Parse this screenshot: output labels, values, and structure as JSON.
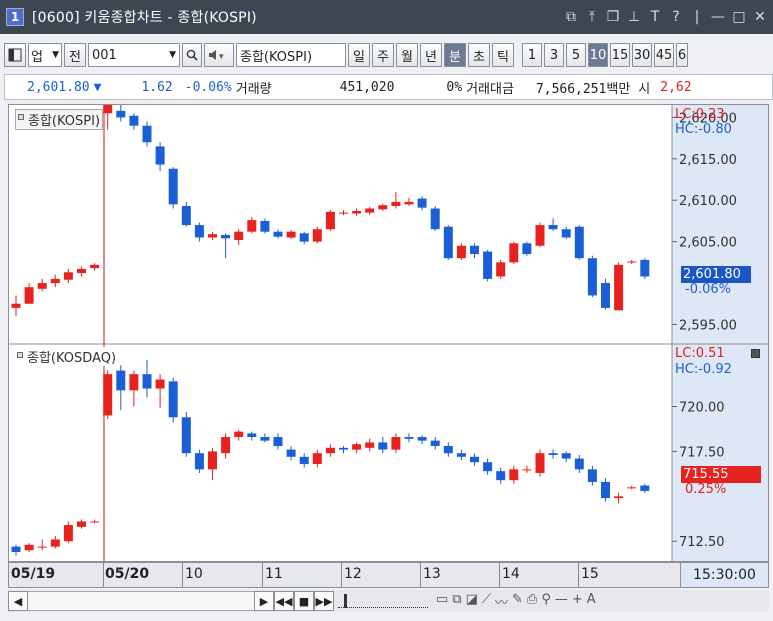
{
  "window": {
    "number": "1",
    "title": "[0600] 키움종합차트 - 종합(KOSPI)",
    "controls": [
      "⧉",
      "⤒",
      "❐",
      "⊥",
      "T",
      "?",
      "|",
      "—",
      "□",
      "✕"
    ]
  },
  "toolbar": {
    "market": "업",
    "market_full": "전",
    "code": "001",
    "name": "종합(KOSPI)",
    "periods": [
      "일",
      "주",
      "월",
      "년",
      "분",
      "초",
      "틱"
    ],
    "active_period": "분",
    "intervals": [
      "1",
      "3",
      "5",
      "10",
      "15",
      "30",
      "45",
      "6"
    ],
    "active_interval": "10"
  },
  "price_line": {
    "price": "2,601.80",
    "arrow": "▼",
    "change": "1.62",
    "change_pct": "-0.06%",
    "volume_label": "거래량",
    "volume": "451,020",
    "volume_pct": "0%",
    "amount_label": "거래대금",
    "amount": "7,566,251백만",
    "open_label": "시",
    "open": "2,62"
  },
  "pane1": {
    "title": "종합(KOSPI)",
    "lc": "LC:0.23",
    "hc": "HC:-0.80",
    "ticks": [
      "2,620.00",
      "2,615.00",
      "2,610.00",
      "2,605.00",
      "2,595.00"
    ],
    "last_price": "2,601.80",
    "last_pct": "-0.06%"
  },
  "pane2": {
    "title": "종합(KOSDAQ)",
    "lc": "LC:0.51",
    "hc": "HC:-0.92",
    "ticks": [
      "720.00",
      "717.50",
      "712.50"
    ],
    "last_price": "715.55",
    "last_pct": "0.25%"
  },
  "x_axis": {
    "labels": [
      "05/19",
      "05/20",
      "10",
      "11",
      "12",
      "13",
      "14",
      "15"
    ],
    "time": "15:30:00"
  },
  "colors": {
    "up": "#e8231f",
    "down": "#1b5fd6",
    "divider": "#d01515"
  },
  "chart_data": [
    {
      "type": "candlestick",
      "title": "종합(KOSPI)",
      "ylim": [
        2593,
        2621.5
      ],
      "candles": [
        [
          2597.0,
          2597.5,
          2596.0,
          2598.5
        ],
        [
          2597.5,
          2599.5,
          2597.5,
          2600.0
        ],
        [
          2599.3,
          2600.0,
          2599.0,
          2600.5
        ],
        [
          2600.0,
          2600.5,
          2599.5,
          2601.0
        ],
        [
          2600.4,
          2601.3,
          2600.0,
          2601.7
        ],
        [
          2601.2,
          2601.7,
          2600.8,
          2602.0
        ],
        [
          2601.8,
          2602.2,
          2601.5,
          2602.4
        ],
        [
          2620.5,
          2623.0,
          2618.5,
          2623.5
        ],
        [
          2620.8,
          2620.0,
          2619.5,
          2621.5
        ],
        [
          2620.2,
          2619.0,
          2618.5,
          2620.5
        ],
        [
          2619.0,
          2617.0,
          2616.5,
          2619.5
        ],
        [
          2616.5,
          2614.3,
          2613.5,
          2617.0
        ],
        [
          2613.8,
          2609.5,
          2609.0,
          2614.0
        ],
        [
          2609.3,
          2607.0,
          2606.8,
          2609.8
        ],
        [
          2607.0,
          2605.5,
          2605.0,
          2607.3
        ],
        [
          2605.5,
          2605.9,
          2605.2,
          2606.2
        ],
        [
          2605.8,
          2605.4,
          2603.0,
          2606.0
        ],
        [
          2605.2,
          2606.2,
          2604.6,
          2606.5
        ],
        [
          2606.2,
          2607.6,
          2606.0,
          2608.0
        ],
        [
          2607.5,
          2606.2,
          2606.0,
          2607.8
        ],
        [
          2606.2,
          2605.6,
          2605.4,
          2606.5
        ],
        [
          2605.5,
          2606.2,
          2605.3,
          2606.4
        ],
        [
          2606.0,
          2605.0,
          2604.7,
          2606.2
        ],
        [
          2605.0,
          2606.5,
          2604.8,
          2606.8
        ],
        [
          2606.5,
          2608.6,
          2606.3,
          2608.8
        ],
        [
          2608.5,
          2608.5,
          2608.2,
          2608.8
        ],
        [
          2608.4,
          2608.7,
          2608.1,
          2609.0
        ],
        [
          2608.5,
          2609.0,
          2608.2,
          2609.2
        ],
        [
          2608.9,
          2609.4,
          2608.7,
          2609.6
        ],
        [
          2609.3,
          2609.8,
          2609.0,
          2611.0
        ],
        [
          2609.5,
          2609.8,
          2609.3,
          2610.3
        ],
        [
          2610.2,
          2609.1,
          2608.8,
          2610.5
        ],
        [
          2609.0,
          2606.5,
          2606.3,
          2609.3
        ],
        [
          2606.8,
          2603.0,
          2602.8,
          2607.0
        ],
        [
          2603.0,
          2604.5,
          2602.8,
          2604.8
        ],
        [
          2604.5,
          2603.5,
          2603.0,
          2604.8
        ],
        [
          2603.8,
          2600.5,
          2600.2,
          2604.0
        ],
        [
          2600.8,
          2602.5,
          2600.5,
          2602.8
        ],
        [
          2602.5,
          2604.8,
          2602.3,
          2605.0
        ],
        [
          2604.8,
          2603.5,
          2603.3,
          2605.0
        ],
        [
          2604.5,
          2607.0,
          2604.3,
          2607.3
        ],
        [
          2607.0,
          2606.5,
          2606.3,
          2607.8
        ],
        [
          2606.5,
          2605.5,
          2605.3,
          2606.8
        ],
        [
          2606.8,
          2603.0,
          2602.8,
          2607.0
        ],
        [
          2603.0,
          2598.5,
          2598.3,
          2603.3
        ],
        [
          2600.0,
          2597.0,
          2596.8,
          2600.5
        ],
        [
          2596.7,
          2602.2,
          2596.7,
          2602.5
        ],
        [
          2602.5,
          2602.6,
          2602.3,
          2602.8
        ],
        [
          2602.8,
          2600.8,
          2600.5,
          2603.0
        ]
      ]
    },
    {
      "type": "candlestick",
      "title": "종합(KOSDAQ)",
      "ylim": [
        711.4,
        723.2
      ],
      "candles": [
        [
          712.2,
          711.9,
          711.7,
          712.3
        ],
        [
          712.0,
          712.3,
          711.9,
          712.4
        ],
        [
          712.2,
          712.2,
          712.0,
          712.6
        ],
        [
          712.2,
          712.6,
          712.1,
          712.8
        ],
        [
          712.5,
          713.4,
          712.4,
          713.6
        ],
        [
          713.3,
          713.6,
          713.2,
          713.7
        ],
        [
          713.6,
          713.6,
          713.5,
          713.7
        ],
        [
          719.5,
          721.8,
          719.3,
          722.0
        ],
        [
          722.0,
          720.9,
          719.8,
          722.3
        ],
        [
          720.9,
          721.8,
          720.0,
          722.0
        ],
        [
          721.8,
          721.0,
          720.5,
          722.6
        ],
        [
          721.0,
          721.5,
          719.9,
          721.8
        ],
        [
          721.4,
          719.4,
          719.1,
          721.6
        ],
        [
          719.4,
          717.4,
          717.2,
          719.7
        ],
        [
          717.4,
          716.5,
          716.3,
          717.6
        ],
        [
          716.5,
          717.5,
          715.9,
          717.7
        ],
        [
          717.4,
          718.3,
          717.1,
          718.5
        ],
        [
          718.3,
          718.6,
          718.1,
          718.7
        ],
        [
          718.5,
          718.3,
          718.1,
          718.6
        ],
        [
          718.3,
          718.1,
          718.0,
          718.5
        ],
        [
          718.3,
          717.8,
          717.6,
          718.5
        ],
        [
          717.6,
          717.2,
          717.0,
          717.8
        ],
        [
          717.2,
          716.8,
          716.6,
          717.4
        ],
        [
          716.8,
          717.4,
          716.6,
          717.6
        ],
        [
          717.4,
          717.7,
          717.2,
          717.9
        ],
        [
          717.7,
          717.6,
          717.4,
          717.8
        ],
        [
          717.6,
          717.9,
          717.4,
          718.0
        ],
        [
          717.7,
          718.0,
          717.5,
          718.2
        ],
        [
          718.0,
          717.6,
          717.4,
          718.3
        ],
        [
          717.6,
          718.3,
          717.4,
          718.5
        ],
        [
          718.3,
          718.2,
          718.0,
          718.5
        ],
        [
          718.3,
          718.1,
          717.9,
          718.4
        ],
        [
          718.1,
          717.8,
          717.6,
          718.3
        ],
        [
          717.8,
          717.4,
          717.2,
          718.0
        ],
        [
          717.4,
          717.2,
          717.0,
          717.6
        ],
        [
          717.2,
          716.9,
          716.7,
          717.4
        ],
        [
          716.9,
          716.4,
          716.2,
          717.1
        ],
        [
          716.4,
          715.9,
          715.7,
          716.6
        ],
        [
          715.9,
          716.5,
          715.7,
          716.7
        ],
        [
          716.5,
          716.5,
          716.3,
          716.7
        ],
        [
          716.3,
          717.4,
          716.1,
          717.6
        ],
        [
          717.4,
          717.3,
          717.1,
          717.6
        ],
        [
          717.4,
          717.1,
          716.9,
          717.5
        ],
        [
          717.1,
          716.5,
          716.3,
          717.3
        ],
        [
          716.5,
          715.8,
          715.6,
          716.7
        ],
        [
          715.8,
          714.9,
          714.7,
          716.0
        ],
        [
          714.9,
          715.0,
          714.6,
          715.2
        ],
        [
          715.5,
          715.5,
          715.4,
          715.6
        ],
        [
          715.6,
          715.3,
          715.2,
          715.7
        ]
      ]
    }
  ]
}
